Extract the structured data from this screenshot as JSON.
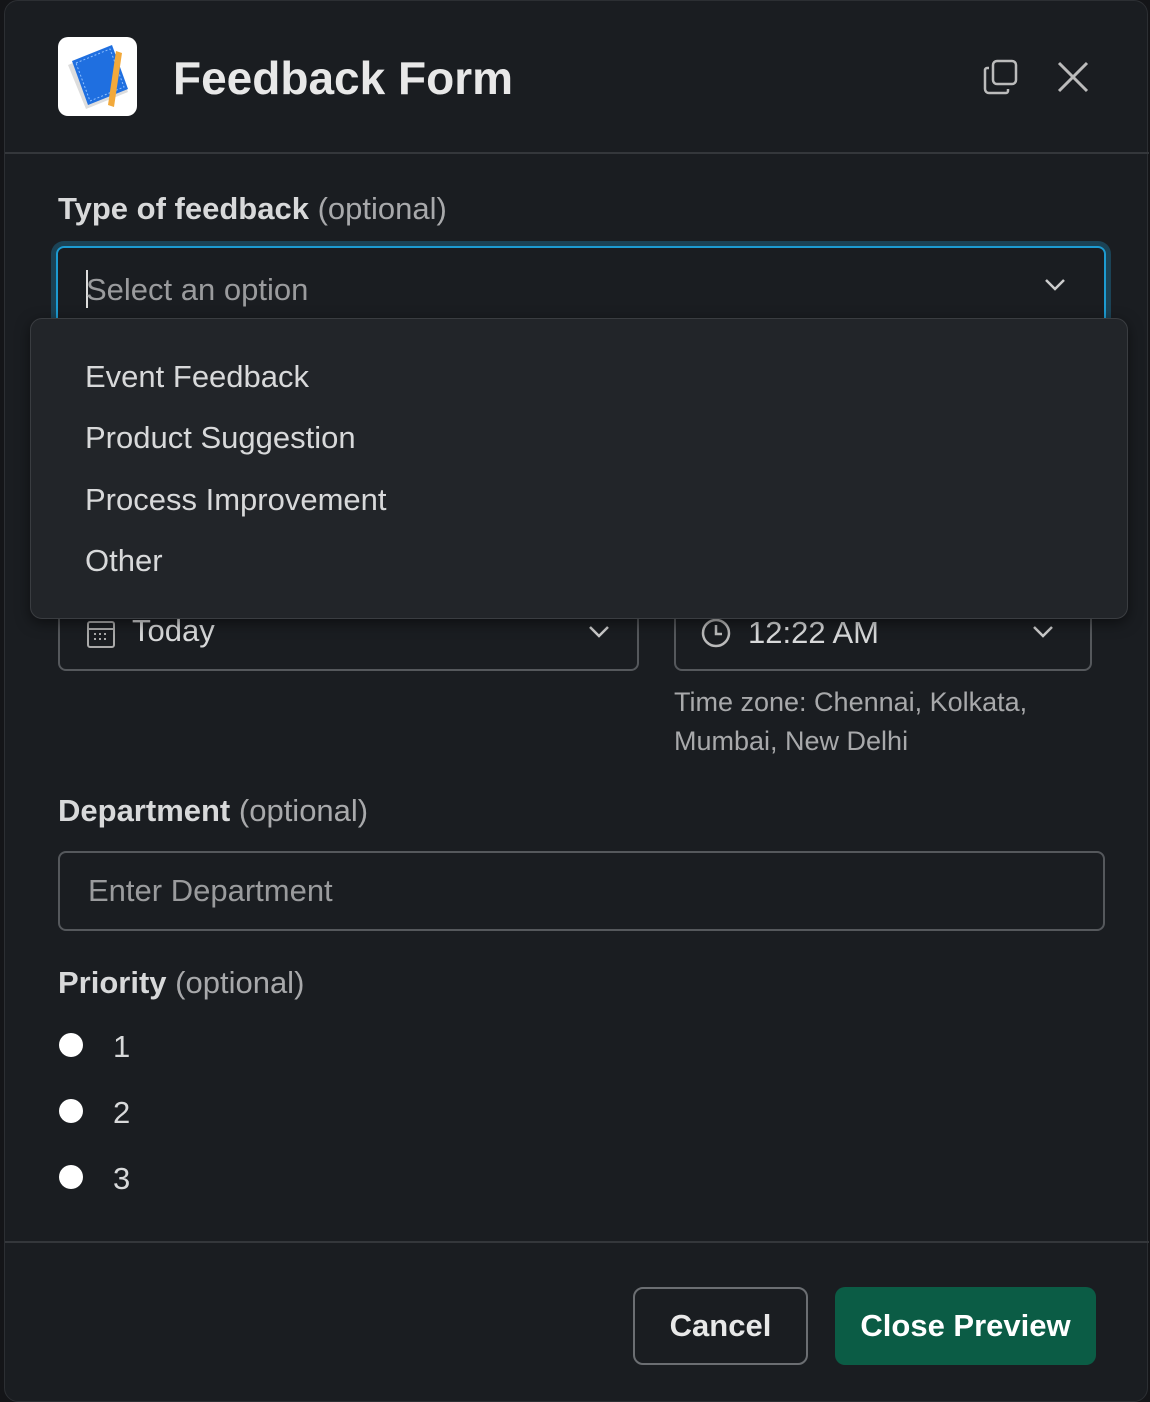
{
  "header": {
    "title": "Feedback Form",
    "icon": "notebook-icon"
  },
  "feedback_type": {
    "label": "Type of feedback",
    "optional": "(optional)",
    "placeholder": "Select an option",
    "options": [
      "Event Feedback",
      "Product Suggestion",
      "Process Improvement",
      "Other"
    ]
  },
  "date": {
    "value": "Today"
  },
  "time": {
    "value": "12:22 AM",
    "timezone_line1": "Time zone: Chennai, Kolkata,",
    "timezone_line2": "Mumbai, New Delhi"
  },
  "department": {
    "label": "Department",
    "optional": "(optional)",
    "placeholder": "Enter Department"
  },
  "priority": {
    "label": "Priority",
    "optional": "(optional)",
    "options": [
      "1",
      "2",
      "3"
    ]
  },
  "footer": {
    "cancel": "Cancel",
    "close_preview": "Close Preview"
  },
  "colors": {
    "accent": "#1d9bd1",
    "primary_button": "#0b5c45",
    "background": "#1a1d21"
  }
}
